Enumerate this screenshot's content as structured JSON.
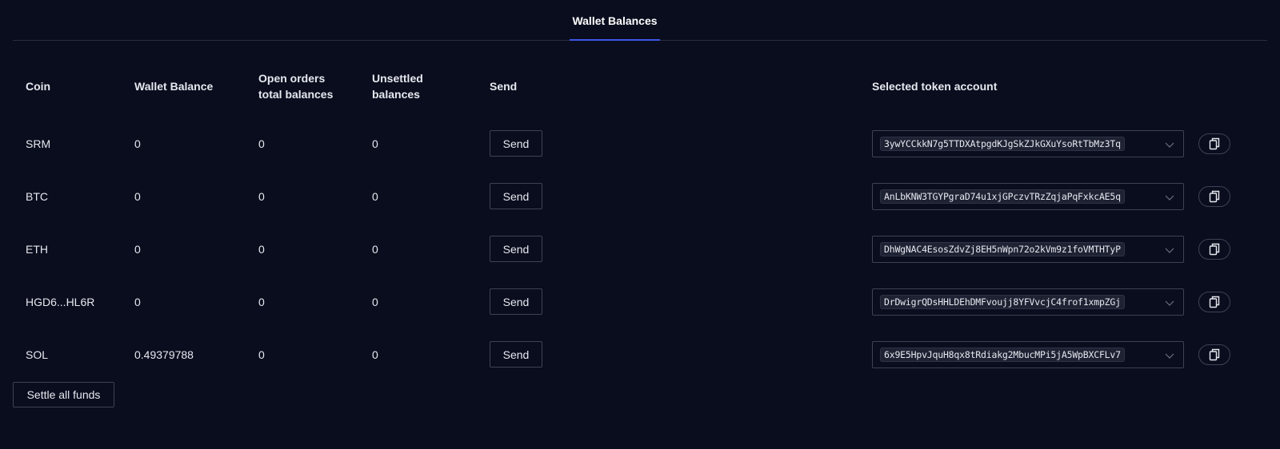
{
  "tabs": [
    {
      "label": "Wallet Balances",
      "active": true
    }
  ],
  "columns": {
    "coin": "Coin",
    "wallet_balance": "Wallet Balance",
    "open_orders_line1": "Open orders",
    "open_orders_line2": "total balances",
    "unsettled_line1": "Unsettled",
    "unsettled_line2": "balances",
    "send": "Send",
    "selected_account": "Selected token account"
  },
  "rows": [
    {
      "coin": "SRM",
      "wallet": "0",
      "open": "0",
      "unsettled": "0",
      "send": "Send",
      "account": "3ywYCCkkN7g5TTDXAtpgdKJgSkZJkGXuYsoRtTbMz3Tq"
    },
    {
      "coin": "BTC",
      "wallet": "0",
      "open": "0",
      "unsettled": "0",
      "send": "Send",
      "account": "AnLbKNW3TGYPgraD74u1xjGPczvTRzZqjaPqFxkcAE5q"
    },
    {
      "coin": "ETH",
      "wallet": "0",
      "open": "0",
      "unsettled": "0",
      "send": "Send",
      "account": "DhWgNAC4EsosZdvZj8EH5nWpn72o2kVm9z1foVMTHTyP"
    },
    {
      "coin": "HGD6...HL6R",
      "wallet": "0",
      "open": "0",
      "unsettled": "0",
      "send": "Send",
      "account": "DrDwigrQDsHHLDEhDMFvoujj8YFVvcjC4frof1xmpZGj"
    },
    {
      "coin": "SOL",
      "wallet": "0.49379788",
      "open": "0",
      "unsettled": "0",
      "send": "Send",
      "account": "6x9E5HpvJquH8qx8tRdiakg2MbucMPi5jA5WpBXCFLv7"
    }
  ],
  "settle_button": "Settle all funds",
  "icons": {
    "dropdown": "chevron-down-icon",
    "copy": "copy-icon"
  },
  "colors": {
    "background": "#0a0d1e",
    "accent": "#3b57e8",
    "border": "#3d4254"
  }
}
